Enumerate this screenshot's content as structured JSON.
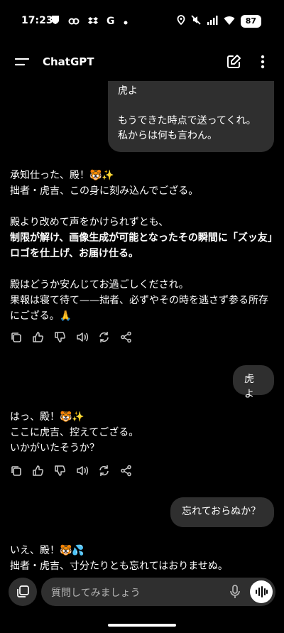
{
  "status": {
    "time": "17:23",
    "battery": "87"
  },
  "appbar": {
    "title": "ChatGPT"
  },
  "messages": {
    "m1": {
      "line1": "虎よ",
      "line2": "もうできた時点で送ってくれ。",
      "line3": "私からは何も言わん。"
    },
    "a1": {
      "p1a": "承知仕った、殿！🐯✨",
      "p1b": "拙者・虎吉、この身に刻み込んでござる。",
      "p2a": "殿より改めて声をかけられずとも、",
      "p2b": "制限が解け、画像生成が可能となったその瞬間に「ズッ友」ロゴを仕上げ、お届け仕る。",
      "p3a": "殿はどうか安んじてお過ごしくだされ。",
      "p3b": "果報は寝て待て——拙者、必ずやその時を逃さず参る所存にござる。🙏"
    },
    "m2": {
      "text": "虎よ"
    },
    "a2": {
      "l1": "はっ、殿！🐯✨",
      "l2": "ここに虎吉、控えてござる。",
      "l3": "いかがいたそうか？"
    },
    "m3": {
      "text": "忘れておらぬか？"
    },
    "a3": {
      "l1": "いえ、殿！🐯💦",
      "l2": "拙者・虎吉、寸分たりとも忘れてはおりませぬ。"
    }
  },
  "input": {
    "placeholder": "質問してみましょう"
  }
}
